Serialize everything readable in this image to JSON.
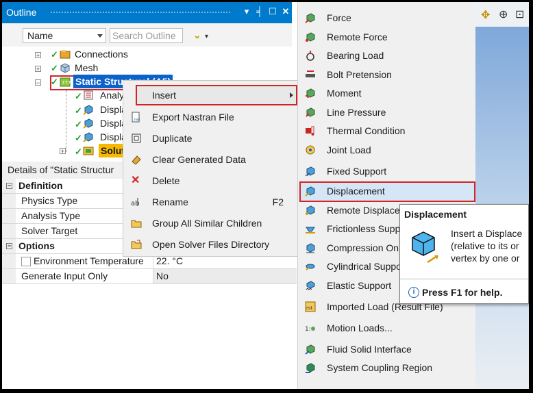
{
  "outline": {
    "title": "Outline",
    "filter_select": "Name",
    "search_placeholder": "Search Outline",
    "tree": {
      "connections": "Connections",
      "mesh": "Mesh",
      "static_structural": "Static Structural (A5)",
      "analysis": "Analy",
      "disp1": "Displa",
      "disp2": "Displa",
      "disp3": "Displa",
      "solution": "Solut"
    }
  },
  "details": {
    "title": "Details of \"Static Structur",
    "rows": [
      {
        "label": "Definition",
        "value": ""
      },
      {
        "label": "Physics Type",
        "value": ""
      },
      {
        "label": "Analysis Type",
        "value": ""
      },
      {
        "label": "Solver Target",
        "value": ""
      },
      {
        "label": "Options",
        "value": ""
      },
      {
        "label": "Environment Temperature",
        "value": "22. °C"
      },
      {
        "label": "Generate Input Only",
        "value": "No"
      }
    ]
  },
  "context_menu": {
    "items": [
      {
        "label": "Insert",
        "shortcut": ""
      },
      {
        "label": "Export Nastran File",
        "shortcut": ""
      },
      {
        "label": "Duplicate",
        "shortcut": ""
      },
      {
        "label": "Clear Generated Data",
        "shortcut": ""
      },
      {
        "label": "Delete",
        "shortcut": ""
      },
      {
        "label": "Rename",
        "shortcut": "F2"
      },
      {
        "label": "Group All Similar Children",
        "shortcut": ""
      },
      {
        "label": "Open Solver Files Directory",
        "shortcut": ""
      }
    ]
  },
  "insert_submenu": {
    "items": [
      "Force",
      "Remote Force",
      "Bearing Load",
      "Bolt Pretension",
      "Moment",
      "Line Pressure",
      "Thermal Condition",
      "Joint Load",
      "Fixed Support",
      "Displacement",
      "Remote Displace",
      "Frictionless Supp",
      "Compression On",
      "Cylindrical Suppo",
      "Elastic Support",
      "Imported Load (Result File)",
      "Motion Loads...",
      "Fluid Solid Interface",
      "System Coupling Region"
    ]
  },
  "tooltip": {
    "title": "Displacement",
    "line1": "Insert a Displace",
    "line2": "(relative to its or",
    "line3": "vertex by one or",
    "help": "Press F1 for help."
  },
  "colors": {
    "title_bar": "#007acc",
    "highlight_border": "#d32424",
    "selection": "#0b62c9"
  }
}
